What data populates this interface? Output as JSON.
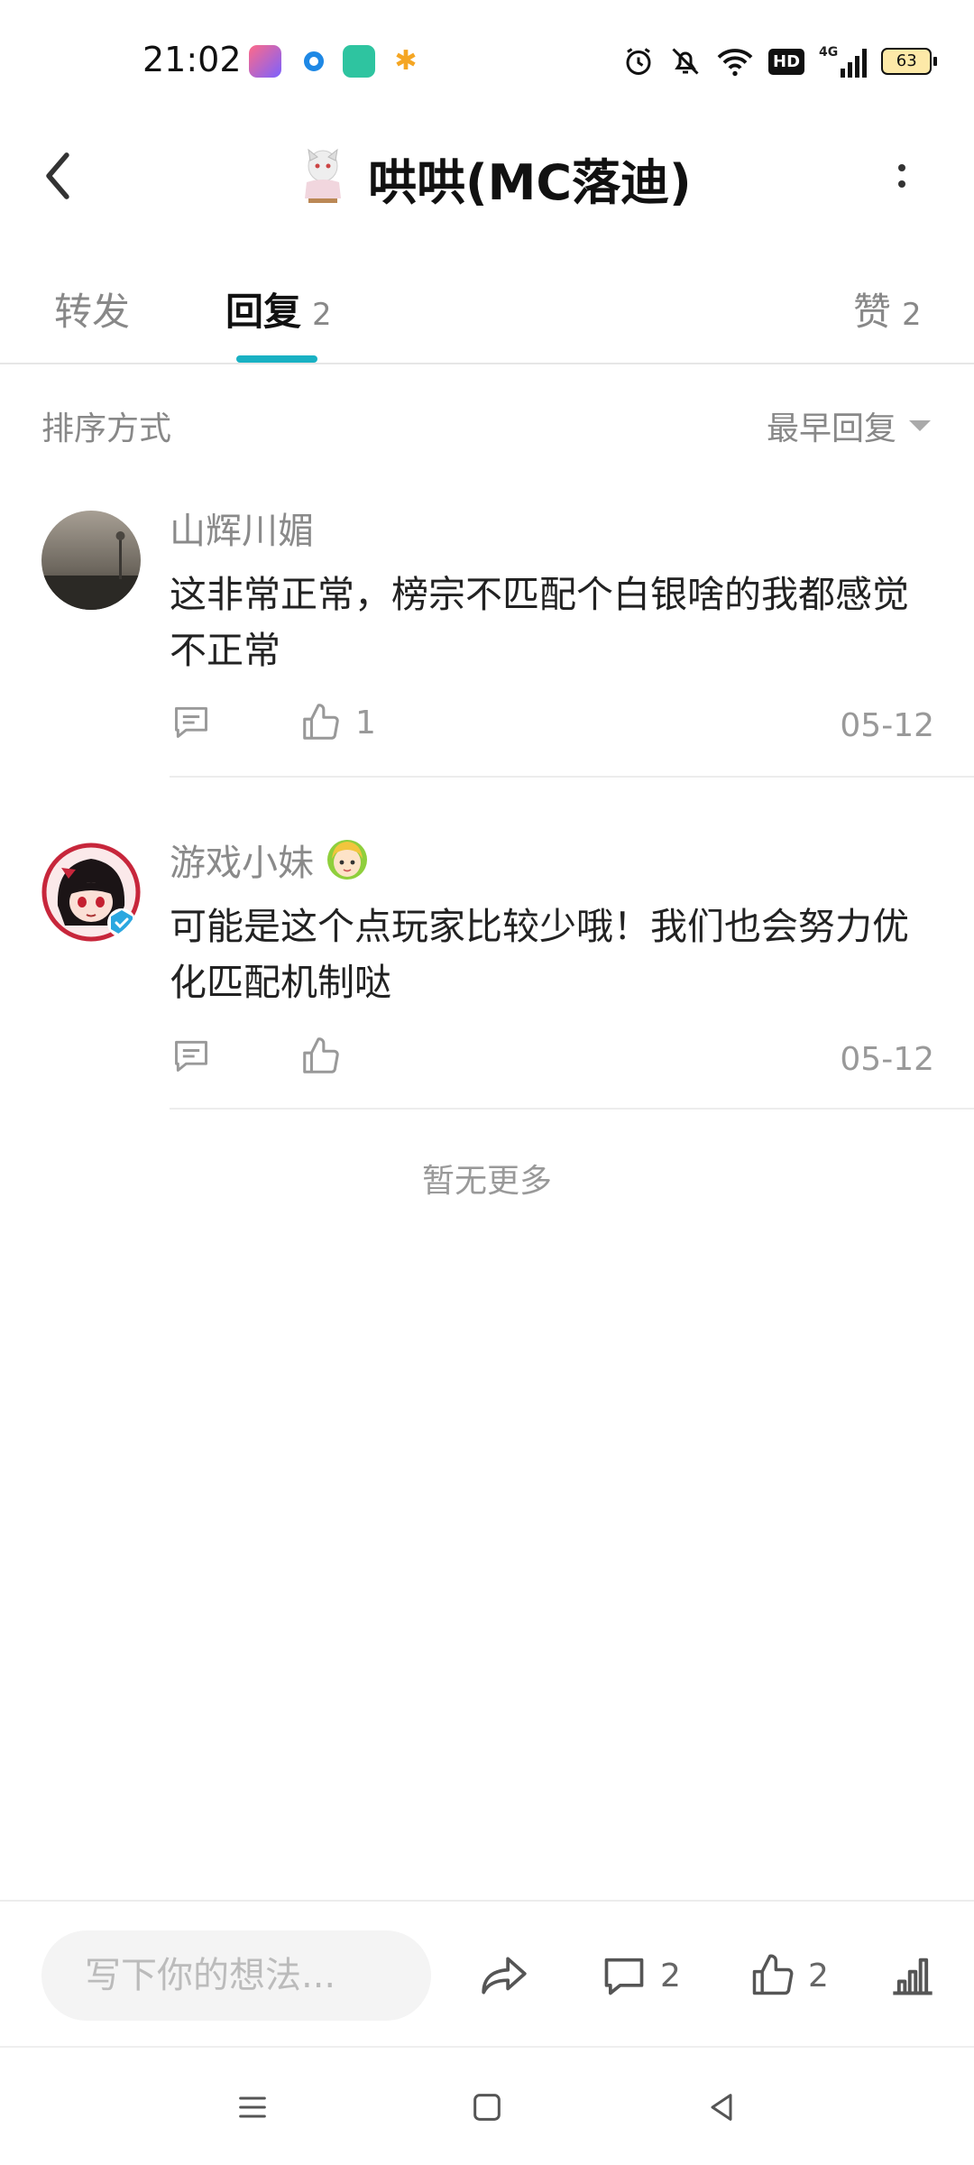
{
  "status_bar": {
    "time": "21:02",
    "icons_right": [
      "alarm-icon",
      "bell-off-icon",
      "wifi-icon",
      "hd-icon",
      "4g-signal-icon",
      "battery-icon"
    ],
    "network_label": "4G",
    "hd_label": "HD",
    "battery_level": "63"
  },
  "header": {
    "title": "哄哄(MC落迪)",
    "back_icon": "chevron-left-icon",
    "more_icon": "more-vertical-icon"
  },
  "tabs": [
    {
      "label": "转发",
      "count": ""
    },
    {
      "label": "回复",
      "count": "2"
    },
    {
      "label": "赞",
      "count": "2"
    }
  ],
  "active_tab": "回复",
  "accent_color": "#19b1c3",
  "sort": {
    "label": "排序方式",
    "value": "最早回复"
  },
  "comments": [
    {
      "name": "山辉川媚",
      "text": "这非常正常，榜宗不匹配个白银啥的我都感觉不正常",
      "like_count": "1",
      "date": "05-12"
    },
    {
      "name": "游戏小妹",
      "text": "可能是这个点玩家比较少哦！我们也会努力优化匹配机制哒",
      "like_count": "",
      "date": "05-12",
      "verified": true
    }
  ],
  "no_more_text": "暂无更多",
  "bottom_bar": {
    "input_placeholder": "写下你的想法...",
    "comment_count": "2",
    "like_count": "2"
  }
}
